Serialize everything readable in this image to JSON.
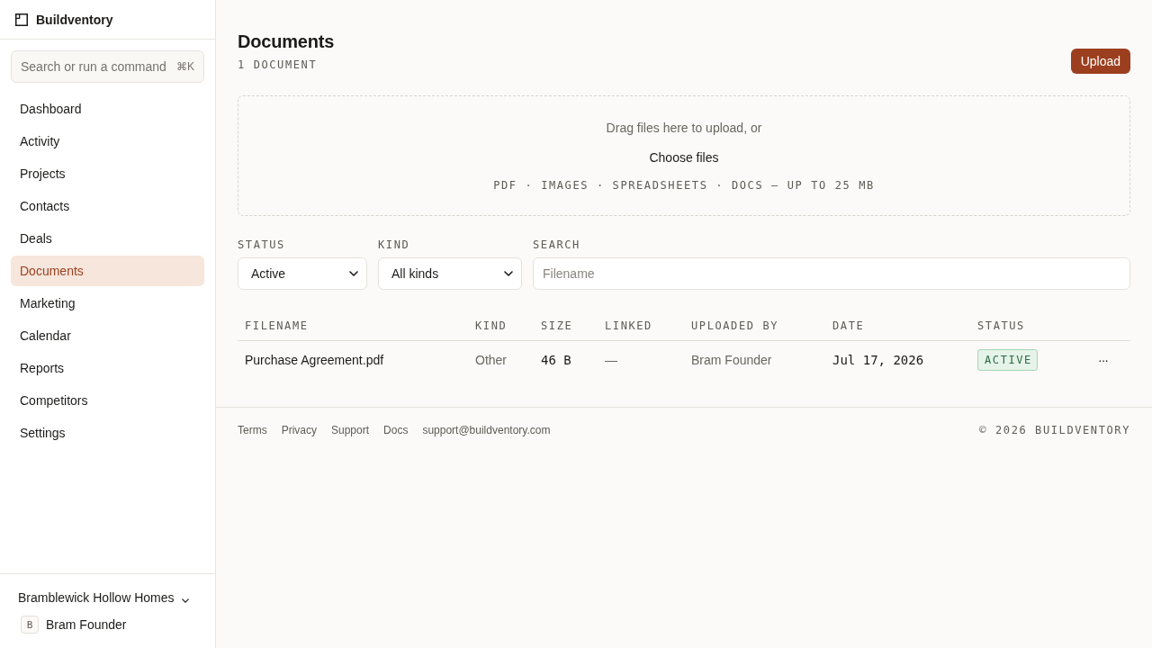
{
  "sidebar": {
    "brand": "Buildventory",
    "search": {
      "placeholder": "Search or run a command",
      "shortcut": "⌘K"
    },
    "items": [
      {
        "label": "Dashboard",
        "selected": false
      },
      {
        "label": "Activity",
        "selected": false
      },
      {
        "label": "Projects",
        "selected": false
      },
      {
        "label": "Contacts",
        "selected": false
      },
      {
        "label": "Deals",
        "selected": false
      },
      {
        "label": "Documents",
        "selected": true
      },
      {
        "label": "Marketing",
        "selected": false
      },
      {
        "label": "Calendar",
        "selected": false
      },
      {
        "label": "Reports",
        "selected": false
      },
      {
        "label": "Competitors",
        "selected": false
      },
      {
        "label": "Settings",
        "selected": false
      }
    ],
    "workspace": {
      "name": "Bramblewick Hollow Homes"
    },
    "user": {
      "initial": "B",
      "name": "Bram Founder"
    }
  },
  "header": {
    "title": "Documents",
    "count": "1 DOCUMENT",
    "upload_button": "Upload"
  },
  "dropzone": {
    "prompt": "Drag files here to upload, or",
    "choose_button": "Choose files",
    "hint": "PDF · IMAGES · SPREADSHEETS · DOCS — UP TO 25 MB"
  },
  "filters": [
    {
      "kind": "select",
      "label": "STATUS",
      "value": "Active"
    },
    {
      "kind": "select",
      "label": "KIND",
      "value": "All kinds"
    },
    {
      "kind": "text",
      "label": "SEARCH",
      "placeholder": "Filename"
    }
  ],
  "table": {
    "columns": [
      "FILENAME",
      "KIND",
      "SIZE",
      "LINKED",
      "UPLOADED BY",
      "DATE",
      "STATUS"
    ],
    "rows": [
      {
        "filename": "Purchase Agreement.pdf",
        "kind": "Other",
        "size": "46 B",
        "linked": "—",
        "uploaded_by": "Bram Founder",
        "date": "Jul 17, 2026",
        "status": "ACTIVE",
        "actions": "···"
      }
    ]
  },
  "footer": {
    "links": [
      "Terms",
      "Privacy",
      "Support",
      "Docs",
      "support@buildventory.com"
    ],
    "copyright": "© 2026 BUILDVENTORY"
  }
}
